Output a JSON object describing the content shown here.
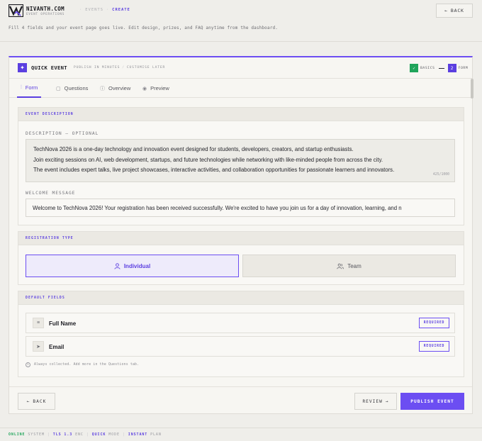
{
  "header": {
    "brand_name": "NIVANTH.COM",
    "brand_sub": "EVENT OPERATIONS",
    "breadcrumb": [
      "EVENTS",
      "CREATE"
    ],
    "back_label": "BACK",
    "intro": "Fill 4 fields and your event page goes live. Edit design, prizes, and FAQ anytime from the dashboard."
  },
  "card": {
    "title": "QUICK EVENT",
    "meta": [
      "PUBLISH IN MINUTES",
      "CUSTOMISE LATER"
    ],
    "steps": [
      {
        "marker": "✓",
        "label": "BASICS"
      },
      {
        "marker": "2",
        "label": "FORM"
      }
    ]
  },
  "tabs": [
    {
      "label": "Form",
      "icon": "sliders-icon"
    },
    {
      "label": "Questions",
      "icon": "clipboard-icon"
    },
    {
      "label": "Overview",
      "icon": "info-icon"
    },
    {
      "label": "Preview",
      "icon": "eye-icon"
    }
  ],
  "description_section": {
    "title": "EVENT DESCRIPTION",
    "description_label": "DESCRIPTION — OPTIONAL",
    "description_lines": [
      "TechNova 2026 is a one-day technology and innovation event designed for students, developers, creators, and startup enthusiasts.",
      "Join exciting sessions on AI, web development, startups, and future technologies while networking with like-minded people from across the city.",
      "The event includes expert talks, live project showcases, interactive activities, and collaboration opportunities for passionate learners and innovators."
    ],
    "char_count": "425/1000",
    "welcome_label": "WELCOME MESSAGE",
    "welcome_value": "Welcome to TechNova 2026! Your registration has been received successfully. We're excited to have you join us for a day of innovation, learning, and n"
  },
  "registration_section": {
    "title": "REGISTRATION TYPE",
    "options": [
      {
        "label": "Individual",
        "icon": "user-icon",
        "selected": true
      },
      {
        "label": "Team",
        "icon": "users-icon",
        "selected": false
      }
    ]
  },
  "fields_section": {
    "title": "DEFAULT FIELDS",
    "fields": [
      {
        "name": "Full Name",
        "icon": "text-lines-icon",
        "badge": "REQUIRED"
      },
      {
        "name": "Email",
        "icon": "send-icon",
        "badge": "REQUIRED"
      }
    ],
    "hint": "Always collected. Add more in the Questions tab."
  },
  "footer": {
    "back_label": "BACK",
    "review_label": "REVIEW",
    "publish_label": "PUBLISH EVENT"
  },
  "status_bar": [
    {
      "key": "ONLINE",
      "value": "SYSTEM"
    },
    {
      "key": "TLS 1.3",
      "value": "ENC"
    },
    {
      "key": "QUICK",
      "value": "MODE"
    },
    {
      "key": "INSTANT",
      "value": "PLAN"
    }
  ],
  "colors": {
    "accent": "#6c4ef2",
    "accent_dark": "#5b3fe0",
    "success": "#1fa45a",
    "background": "#efeeea"
  }
}
